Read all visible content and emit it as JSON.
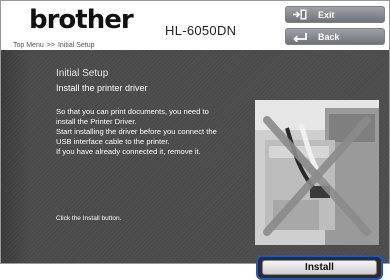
{
  "header": {
    "logo": "brother",
    "model": "HL-6050DN",
    "breadcrumb": {
      "home": "Top Menu",
      "separator": ">>",
      "current": "Initial Setup"
    },
    "exit_label": "Exit",
    "back_label": "Back"
  },
  "main": {
    "title": "Initial Setup",
    "subtitle": "Install the printer driver",
    "body_lines": [
      "So that you can print documents, you need to",
      "install the Printer Driver.",
      "Start installing the driver before you connect the",
      "USB interface cable to the printer.",
      "If you have already connected it, remove it."
    ],
    "instruction": "Click the Install button.",
    "install_label": "Install"
  },
  "colors": {
    "panel_bg": "#4a4a4a",
    "focus_ring": "#1a58c8",
    "header_button": "#7d8186"
  },
  "icons": {
    "exit": "exit-door-icon",
    "back": "back-arrow-icon",
    "photo": "usb-cable-crossed-out-image"
  }
}
